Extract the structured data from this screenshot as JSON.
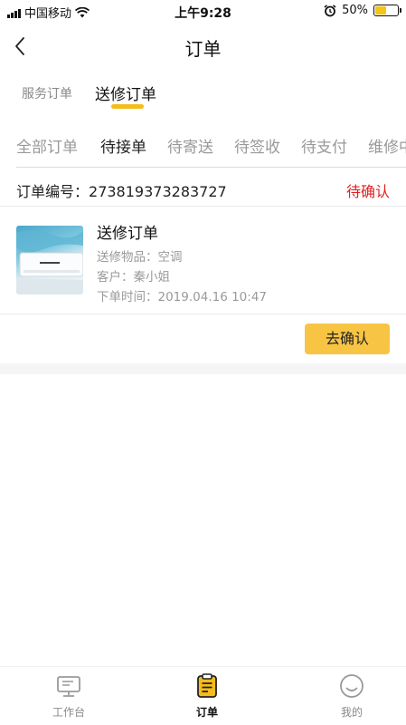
{
  "status_bar": {
    "carrier": "中国移动",
    "time": "上午9:28",
    "battery_percent": "50%",
    "battery_level": 0.5
  },
  "nav": {
    "title": "订单",
    "back_icon": "chevron-left-icon"
  },
  "type_tabs": [
    {
      "label": "服务订单",
      "active": false
    },
    {
      "label": "送修订单",
      "active": true
    }
  ],
  "status_tabs": [
    {
      "label": "全部订单",
      "active": false
    },
    {
      "label": "待接单",
      "active": true
    },
    {
      "label": "待寄送",
      "active": false
    },
    {
      "label": "待签收",
      "active": false
    },
    {
      "label": "待支付",
      "active": false
    },
    {
      "label": "维修中",
      "active": false
    }
  ],
  "order": {
    "number_label": "订单编号：",
    "number": "273819373283727",
    "status": "待确认",
    "title": "送修订单",
    "item_line": "送修物品：空调",
    "customer_line": "客户：秦小姐",
    "time_line": "下单时间：2019.04.16  10:47",
    "image_icon": "air-conditioner-image",
    "action_label": "去确认"
  },
  "tab_bar": [
    {
      "label": "工作台",
      "icon": "monitor-icon",
      "active": false
    },
    {
      "label": "订单",
      "icon": "clipboard-icon",
      "active": true
    },
    {
      "label": "我的",
      "icon": "smiley-icon",
      "active": false
    }
  ],
  "colors": {
    "accent": "#f5bc1a",
    "button": "#f8c444",
    "status_red": "#e02020"
  }
}
